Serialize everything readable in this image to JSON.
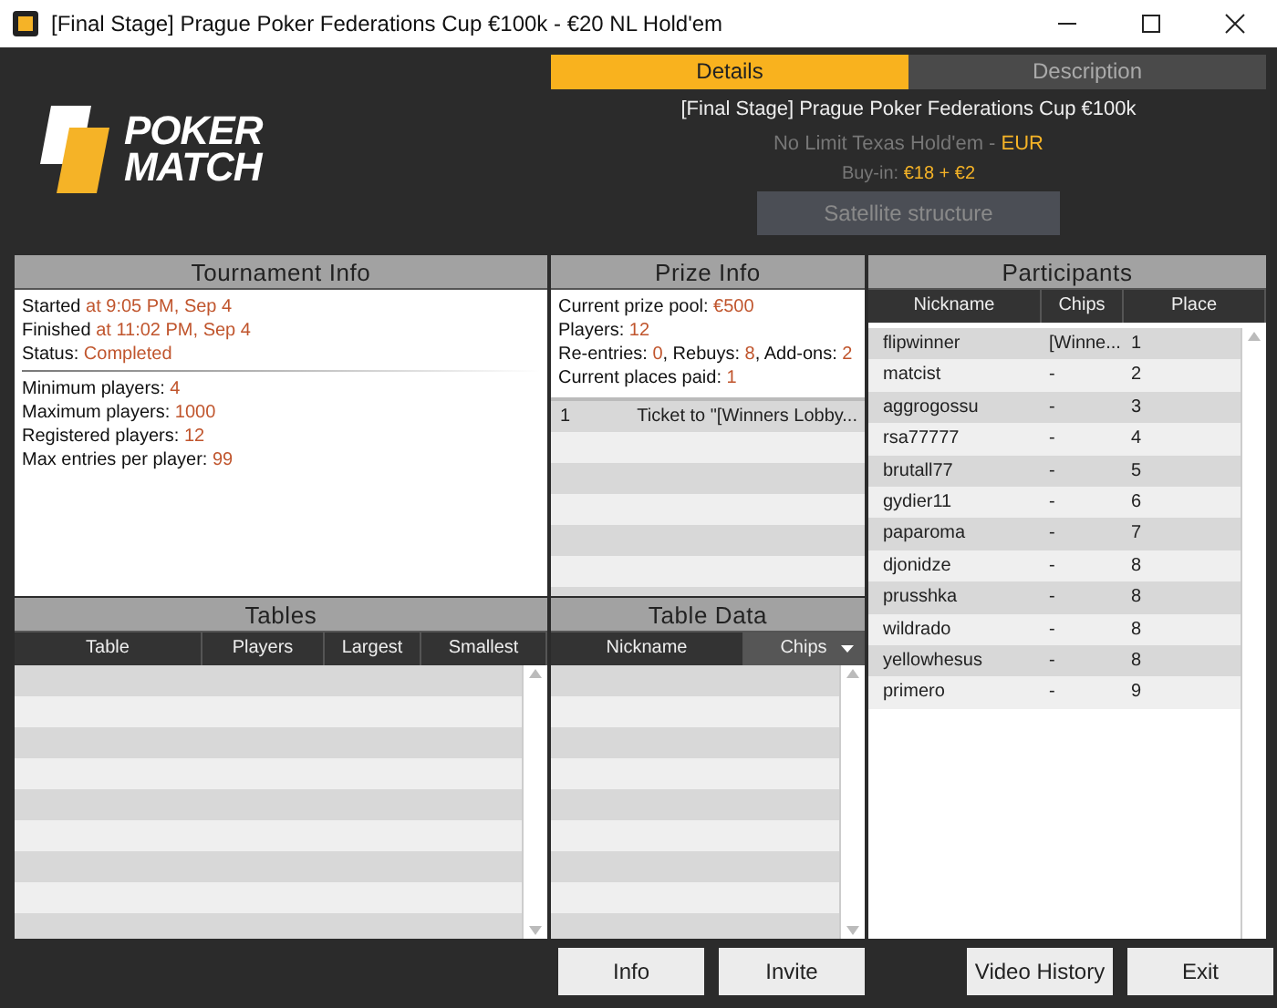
{
  "window": {
    "title": "[Final Stage] Prague Poker Federations Cup €100k - €20 NL Hold'em"
  },
  "logo": {
    "lines": [
      "POKER",
      "MATCH"
    ]
  },
  "header": {
    "tabs": [
      {
        "label": "Details",
        "selected": true
      },
      {
        "label": "Description",
        "selected": false
      }
    ],
    "title": "[Final Stage] Prague Poker Federations Cup €100k",
    "game": "No Limit Texas Hold'em - ",
    "currency": "EUR",
    "buyin_label": "Buy-in: ",
    "buyin_value": "€18 + €2",
    "satellite_button": "Satellite structure"
  },
  "tournament_info": {
    "title": "Tournament Info",
    "groups": [
      [
        {
          "label": "Started ",
          "value": "at 9:05 PM, Sep 4"
        },
        {
          "label": "Finished ",
          "value": "at 11:02 PM, Sep 4"
        },
        {
          "label": "Status: ",
          "value": "Completed"
        }
      ],
      [
        {
          "label": "Minimum players: ",
          "value": "4"
        },
        {
          "label": "Maximum players: ",
          "value": "1000"
        },
        {
          "label": "Registered players: ",
          "value": "12"
        },
        {
          "label": "Max entries per player: ",
          "value": "99"
        }
      ]
    ]
  },
  "prize_info": {
    "title": "Prize Info",
    "lines": [
      [
        {
          "kind": "label",
          "text": "Current prize pool: "
        },
        {
          "kind": "value",
          "text": "€500"
        }
      ],
      [
        {
          "kind": "label",
          "text": "Players: "
        },
        {
          "kind": "value",
          "text": "12"
        }
      ],
      [
        {
          "kind": "label",
          "text": "Re-entries: "
        },
        {
          "kind": "value",
          "text": "0"
        },
        {
          "kind": "label",
          "text": ", Rebuys: "
        },
        {
          "kind": "value",
          "text": "8"
        },
        {
          "kind": "label",
          "text": ", Add-ons: "
        },
        {
          "kind": "value",
          "text": "2"
        }
      ],
      [
        {
          "kind": "label",
          "text": "Current places paid: "
        },
        {
          "kind": "value",
          "text": "1"
        }
      ]
    ],
    "payouts": [
      {
        "place": "1",
        "prize": "Ticket to \"[Winners Lobby..."
      }
    ]
  },
  "participants": {
    "title": "Participants",
    "columns": [
      "Nickname",
      "Chips",
      "Place"
    ],
    "rows": [
      {
        "nickname": "flipwinner",
        "chips": "[Winne...",
        "place": "1"
      },
      {
        "nickname": "matcist",
        "chips": "-",
        "place": "2"
      },
      {
        "nickname": "aggrogossu",
        "chips": "-",
        "place": "3"
      },
      {
        "nickname": "rsa77777",
        "chips": "-",
        "place": "4"
      },
      {
        "nickname": "brutall77",
        "chips": "-",
        "place": "5"
      },
      {
        "nickname": "gydier11",
        "chips": "-",
        "place": "6"
      },
      {
        "nickname": "paparoma",
        "chips": "-",
        "place": "7"
      },
      {
        "nickname": "djonidze",
        "chips": "-",
        "place": "8"
      },
      {
        "nickname": "prusshka",
        "chips": "-",
        "place": "8"
      },
      {
        "nickname": "wildrado",
        "chips": "-",
        "place": "8"
      },
      {
        "nickname": "yellowhesus",
        "chips": "-",
        "place": "8"
      },
      {
        "nickname": "primero",
        "chips": "-",
        "place": "9"
      }
    ]
  },
  "tables": {
    "title": "Tables",
    "columns": [
      {
        "label": "Table",
        "sorted": false
      },
      {
        "label": "Players",
        "sorted": false
      },
      {
        "label": "Largest",
        "sorted": false
      },
      {
        "label": "Smallest",
        "sorted": false
      }
    ]
  },
  "table_data": {
    "title": "Table Data",
    "columns": [
      {
        "label": "Nickname",
        "sorted": false
      },
      {
        "label": "Chips",
        "sorted": true
      }
    ]
  },
  "buttons": [
    "Info",
    "Invite",
    "Video History",
    "Exit"
  ]
}
